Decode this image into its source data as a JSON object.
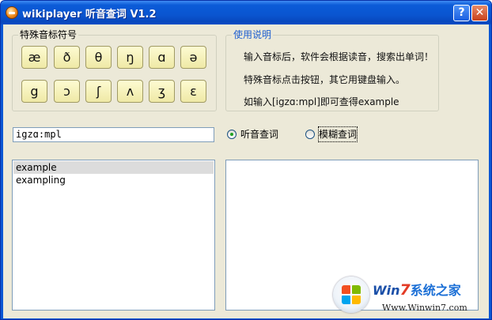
{
  "window": {
    "title": "wikiplayer 听音查词 V1.2",
    "help_label": "?",
    "close_label": "✕"
  },
  "symbols_group": {
    "title": "特殊音标符号",
    "buttons": [
      "æ",
      "ð",
      "θ",
      "ŋ",
      "ɑ",
      "ə",
      "g",
      "ɔ",
      "ʃ",
      "ʌ",
      "ʒ",
      "ɛ"
    ]
  },
  "usage_group": {
    "title": "使用说明",
    "lines": [
      "输入音标后，软件会根据读音，搜索出单词！",
      "特殊音标点击按钮，其它用键盘输入。",
      "如输入[igzɑ:mpl]即可查得example"
    ]
  },
  "search": {
    "value": "igzɑ:mpl"
  },
  "mode": {
    "options": [
      {
        "label": "听音查词",
        "selected": true
      },
      {
        "label": "模糊查词",
        "selected": false
      }
    ]
  },
  "results": {
    "items": [
      "example",
      "exampling"
    ],
    "selected_index": 0
  },
  "watermark": {
    "brand_win": "Win",
    "brand_seven": "7",
    "brand_cn": "系统之家",
    "url": "Www.Winwin7.com"
  },
  "colors": {
    "titlebar": "#0a55d0",
    "client_bg": "#ece9d8",
    "symbol_button": "#f6f1bd",
    "usage_title": "#1f5fd0",
    "radio_dot": "#21a121"
  },
  "icons": {
    "app": "wikiplayer-app-icon",
    "help": "help-icon",
    "close": "close-icon",
    "watermark": "windows-logo-icon"
  }
}
